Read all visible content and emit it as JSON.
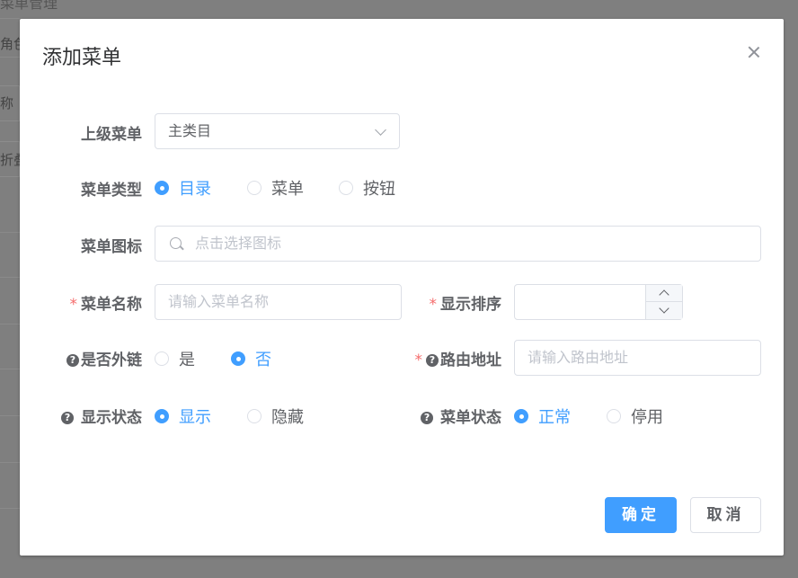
{
  "background": {
    "page_title": "菜单管理",
    "tab_label": "角色管",
    "field_label": "称",
    "fold_button": "折叠"
  },
  "dialog": {
    "title": "添加菜单",
    "parent_menu": {
      "label": "上级菜单",
      "value": "主类目"
    },
    "menu_type": {
      "label": "菜单类型",
      "options": [
        "目录",
        "菜单",
        "按钮"
      ],
      "selected": "目录"
    },
    "menu_icon": {
      "label": "菜单图标",
      "placeholder": "点击选择图标"
    },
    "menu_name": {
      "label": "菜单名称",
      "required": "*",
      "placeholder": "请输入菜单名称"
    },
    "sort_order": {
      "label": "显示排序",
      "required": "*",
      "value": ""
    },
    "is_external": {
      "label": "是否外链",
      "help": "?",
      "options": [
        "是",
        "否"
      ],
      "selected": "否"
    },
    "route_path": {
      "label": "路由地址",
      "required": "*",
      "help": "?",
      "placeholder": "请输入路由地址"
    },
    "visible": {
      "label": "显示状态",
      "help": "?",
      "options": [
        "显示",
        "隐藏"
      ],
      "selected": "显示"
    },
    "status": {
      "label": "菜单状态",
      "help": "?",
      "options": [
        "正常",
        "停用"
      ],
      "selected": "正常"
    },
    "confirm_button": "确定",
    "cancel_button": "取消"
  },
  "colors": {
    "primary": "#409eff",
    "required": "#f56c6c",
    "text": "#606266",
    "overlay": "#7f7f7f"
  }
}
